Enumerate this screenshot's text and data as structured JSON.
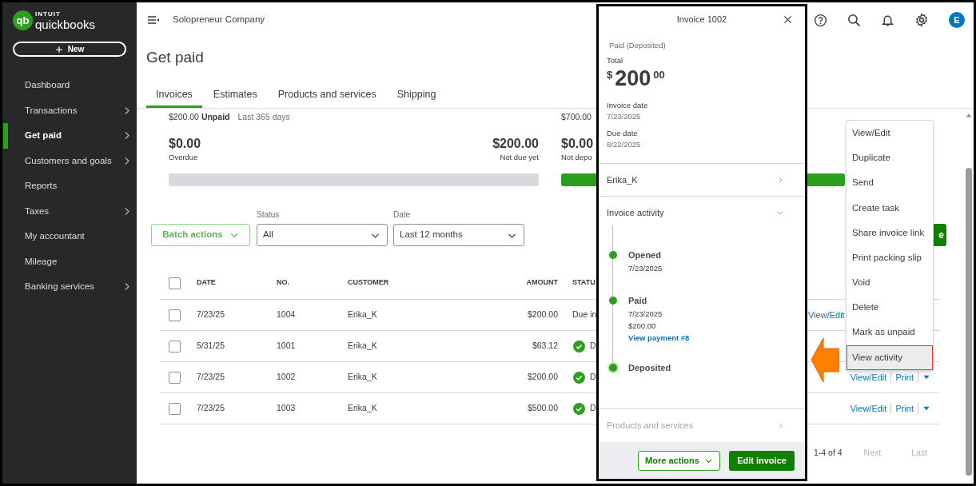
{
  "sidebar": {
    "logo": {
      "mark": "qb",
      "brand": "INTUIT",
      "product": "quickbooks"
    },
    "new_button": "New",
    "items": [
      {
        "label": "Dashboard",
        "selected": false,
        "has_submenu": false
      },
      {
        "label": "Transactions",
        "selected": false,
        "has_submenu": true
      },
      {
        "label": "Get paid",
        "selected": true,
        "has_submenu": true
      },
      {
        "label": "Customers and goals",
        "selected": false,
        "has_submenu": true
      },
      {
        "label": "Reports",
        "selected": false,
        "has_submenu": false
      },
      {
        "label": "Taxes",
        "selected": false,
        "has_submenu": true
      },
      {
        "label": "My accountant",
        "selected": false,
        "has_submenu": false
      },
      {
        "label": "Mileage",
        "selected": false,
        "has_submenu": false
      },
      {
        "label": "Banking services",
        "selected": false,
        "has_submenu": true
      }
    ]
  },
  "header": {
    "company": "Solopreneur Company",
    "avatar": "E"
  },
  "page_title": "Get paid",
  "tabs": [
    {
      "label": "Invoices",
      "selected": true
    },
    {
      "label": "Estimates",
      "selected": false
    },
    {
      "label": "Products and services",
      "selected": false
    },
    {
      "label": "Shipping",
      "selected": false
    }
  ],
  "unpaid": {
    "heading": "$200.00 **Unpaid**",
    "period": "Last 365 days",
    "figures": [
      {
        "amount": "$0.00",
        "label": "Overdue"
      },
      {
        "amount": "$200.00",
        "label": "Not due yet"
      }
    ]
  },
  "paid": {
    "heading": "$700.00",
    "figures": [
      {
        "amount": "$0.00",
        "label": "Not depo"
      }
    ]
  },
  "filters": {
    "batch_button": "Batch actions",
    "status": {
      "label": "Status",
      "value": "All"
    },
    "date": {
      "label": "Date",
      "value": "Last 12 months"
    }
  },
  "create_button": "e",
  "table": {
    "select_all_checked": false,
    "columns": [
      "DATE",
      "NO.",
      "CUSTOMER",
      "AMOUNT",
      "STATU"
    ],
    "rows": [
      {
        "checked": false,
        "date": "7/23/25",
        "no": "1004",
        "customer": "Erika_K",
        "amount": "$200.00",
        "status": "Due in",
        "paid": false,
        "actions": [
          "View/Edit"
        ],
        "caret": false
      },
      {
        "checked": false,
        "date": "5/31/25",
        "no": "1001",
        "customer": "Erika_K",
        "amount": "$63.12",
        "status": "D",
        "paid": true,
        "caret": false
      },
      {
        "checked": false,
        "date": "7/23/25",
        "no": "1002",
        "customer": "Erika_K",
        "amount": "$200.00",
        "status": "D",
        "paid": true,
        "actions": [
          "View/Edit",
          "Print"
        ],
        "caret": true
      },
      {
        "checked": false,
        "date": "7/23/25",
        "no": "1003",
        "customer": "Erika_K",
        "amount": "$500.00",
        "status": "D",
        "paid": true,
        "actions": [
          "View/Edit",
          "Print"
        ],
        "caret": true
      }
    ]
  },
  "pagination": {
    "range": "1-4 of 4",
    "buttons": [
      {
        "label": "Next",
        "disabled": true
      },
      {
        "label": "Last",
        "disabled": true
      }
    ]
  },
  "panel": {
    "title": "Invoice 1002",
    "status": "Paid (Deposited)",
    "total_label": "Total",
    "currency": "$",
    "total_whole": "200",
    "total_cents": "00",
    "fields": [
      {
        "label": "Invoice date",
        "value": "7/23/2025"
      },
      {
        "label": "Due date",
        "value": "8/22/2025"
      }
    ],
    "customer": "Erika_K",
    "activity": {
      "title": "Invoice activity",
      "expanded": true,
      "events": [
        {
          "title": "Opened",
          "lines": [
            "7/23/2025"
          ],
          "current": false
        },
        {
          "title": "Paid",
          "lines": [
            "7/23/2025",
            "$200.00"
          ],
          "link": "View payment #8",
          "current": false
        },
        {
          "title": "Deposited",
          "current": true
        }
      ]
    },
    "products": {
      "label": "Products and services",
      "disabled": true
    },
    "more_actions": "More actions",
    "edit_button": "Edit invoice"
  },
  "menu": {
    "items": [
      {
        "label": "View/Edit",
        "selected": false
      },
      {
        "label": "Duplicate",
        "selected": false
      },
      {
        "label": "Send",
        "selected": false
      },
      {
        "label": "Create task",
        "selected": false
      },
      {
        "label": "Share invoice link",
        "selected": false
      },
      {
        "label": "Print packing slip",
        "selected": false
      },
      {
        "label": "Void",
        "selected": false
      },
      {
        "label": "Delete",
        "selected": false
      },
      {
        "label": "Mark as unpaid",
        "selected": false
      },
      {
        "label": "View activity",
        "selected": true
      }
    ]
  }
}
